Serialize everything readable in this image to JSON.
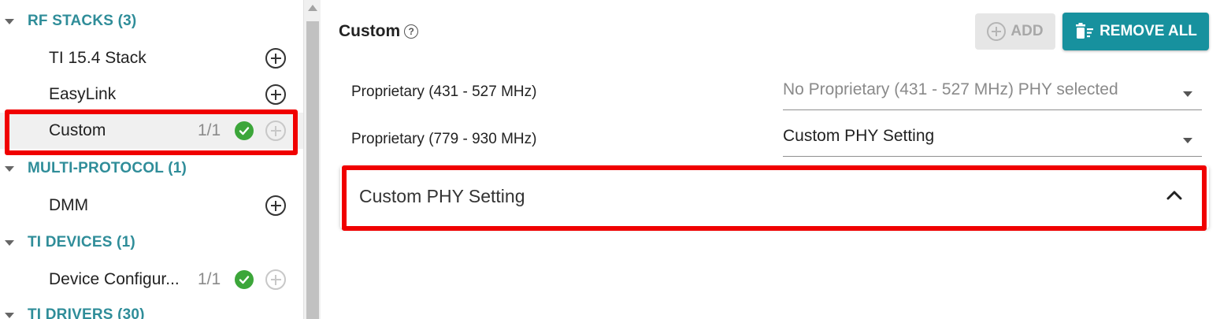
{
  "sidebar": {
    "categories": [
      {
        "label": "RF STACKS (3)"
      },
      {
        "label": "MULTI-PROTOCOL (1)"
      },
      {
        "label": "TI DEVICES (1)"
      },
      {
        "label": "TI DRIVERS (30)"
      }
    ],
    "items": [
      {
        "label": "TI 15.4 Stack",
        "count": "",
        "status": "",
        "add_enabled": true
      },
      {
        "label": "EasyLink",
        "count": "",
        "status": "",
        "add_enabled": true
      },
      {
        "label": "Custom",
        "count": "1/1",
        "status": "ok",
        "add_enabled": false,
        "selected": true
      },
      {
        "label": "DMM",
        "count": "",
        "status": "",
        "add_enabled": true
      },
      {
        "label": "Device Configur...",
        "count": "1/1",
        "status": "ok",
        "add_enabled": false
      }
    ]
  },
  "main": {
    "title": "Custom",
    "help_icon": "question-circle-icon",
    "add_label": "ADD",
    "remove_all_label": "REMOVE ALL",
    "rows": [
      {
        "label": "Proprietary (431 - 527 MHz)",
        "value": "No Proprietary (431 - 527 MHz) PHY selected",
        "placeholder": true
      },
      {
        "label": "Proprietary (779 - 930 MHz)",
        "value": "Custom PHY Setting",
        "placeholder": false
      }
    ],
    "accordion": {
      "title": "Custom PHY Setting",
      "expanded": true
    }
  },
  "colors": {
    "accent": "#17919e",
    "category": "#2f8d99",
    "success": "#3ca63a",
    "highlight": "#f00000"
  }
}
